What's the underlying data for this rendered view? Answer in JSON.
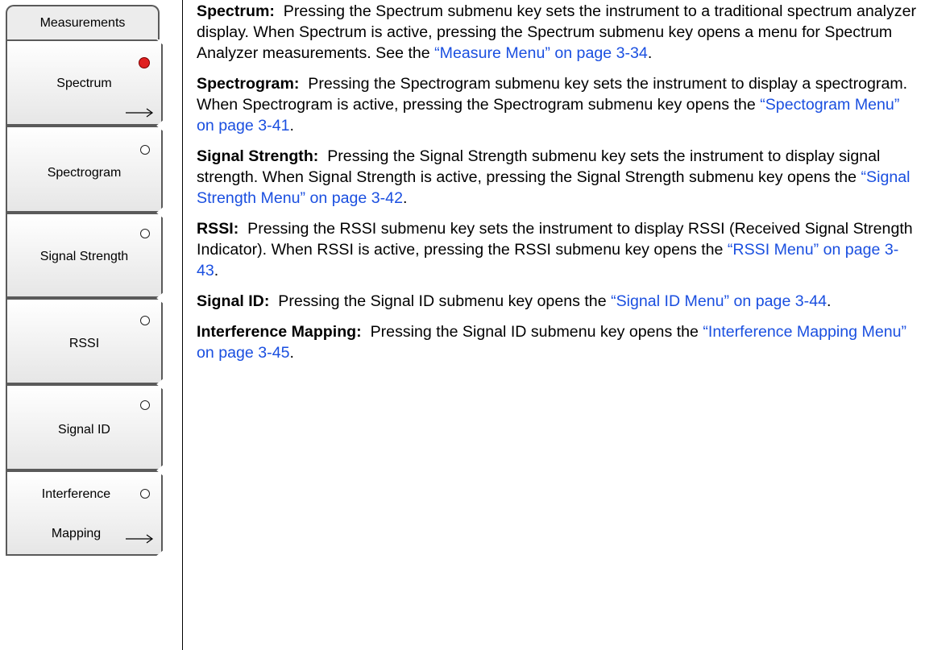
{
  "menu": {
    "title": "Measurements",
    "keys": [
      {
        "label": "Spectrum",
        "active": true
      },
      {
        "label": "Spectrogram",
        "active": false
      },
      {
        "label": "Signal Strength",
        "active": false
      },
      {
        "label": "RSSI",
        "active": false
      },
      {
        "label": "Signal ID",
        "active": false
      },
      {
        "label_line1": "Interference",
        "label_line2": "Mapping",
        "active": false
      }
    ]
  },
  "content": {
    "spectrum": {
      "term": "Spectrum:",
      "text": "Pressing the Spectrum submenu key sets the instrument to a traditional spectrum analyzer display. When Spectrum is active, pressing the Spectrum submenu key opens a menu for Spectrum Analyzer measurements. See the ",
      "link": "“Measure Menu” on page 3-34",
      "tail": "."
    },
    "spectrogram": {
      "term": "Spectrogram:",
      "text": "Pressing the Spectrogram submenu key sets the instrument to display a spectrogram. When Spectrogram is active, pressing the Spectrogram submenu key opens the ",
      "link": "“Spectogram Menu” on page 3-41",
      "tail": "."
    },
    "signal_strength": {
      "term": "Signal Strength:",
      "text": "Pressing the Signal Strength submenu key sets the instrument to display signal strength. When Signal Strength is active, pressing the Signal Strength submenu key opens the ",
      "link": "“Signal Strength Menu” on page 3-42",
      "tail": "."
    },
    "rssi": {
      "term": "RSSI:",
      "text": "Pressing the RSSI submenu key sets the instrument to display RSSI (Received Signal Strength Indicator). When RSSI is active, pressing the RSSI submenu key opens the ",
      "link": "“RSSI Menu” on page 3-43",
      "tail": "."
    },
    "signal_id": {
      "term": "Signal ID:",
      "text": "Pressing the Signal ID submenu key opens the ",
      "link": "“Signal ID Menu” on page 3-44",
      "tail": "."
    },
    "interference": {
      "term": "Interference Mapping:",
      "text": "Pressing the Signal ID submenu key opens the ",
      "link": "“Interference Mapping Menu” on page 3-45",
      "tail": "."
    }
  },
  "colors": {
    "link": "#1a4fe0",
    "active_indicator": "#e02020"
  }
}
